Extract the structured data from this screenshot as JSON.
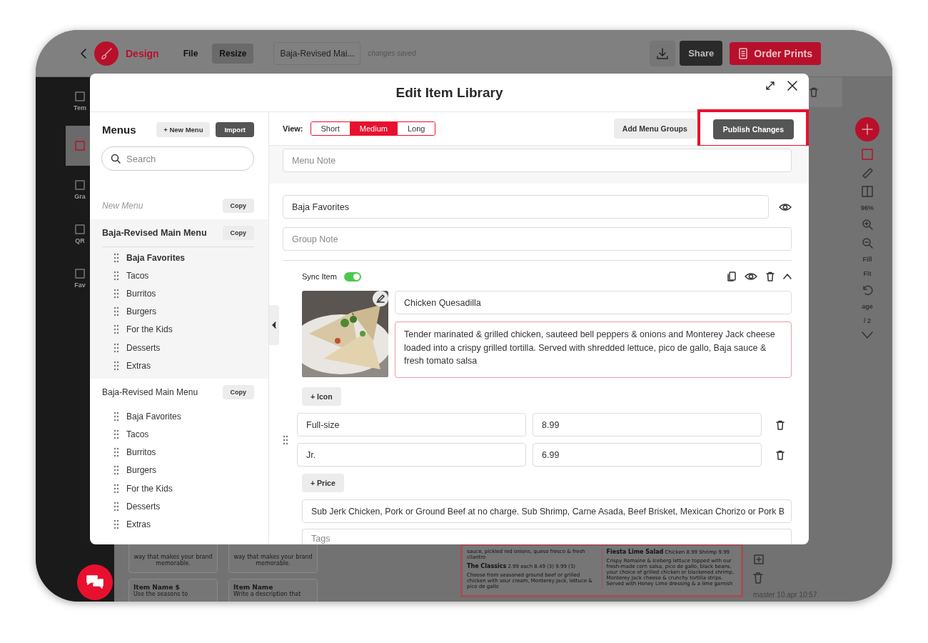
{
  "app_bar": {
    "title": "Design",
    "menu": [
      {
        "label": "File",
        "selected": false
      },
      {
        "label": "Resize",
        "selected": true
      }
    ],
    "document_name": "Baja-Revised Mai...",
    "save_status": "changes saved",
    "share": "Share",
    "order": "Order Prints"
  },
  "left_rail": [
    {
      "label": "Tem",
      "selected": false
    },
    {
      "selected": true
    },
    {
      "label": "Gra",
      "selected": false
    },
    {
      "label": "QR",
      "selected": false
    },
    {
      "label": "Fav",
      "selected": false
    }
  ],
  "right_tools": {
    "zoom": "96%",
    "fill": "Fill",
    "fit": "Fit",
    "page": "age",
    "page_count": "/ 2"
  },
  "canvas": {
    "cards": [
      {
        "lines": [
          "way that makes your brand",
          "memorable."
        ]
      },
      {
        "lines": [
          "way that makes your brand",
          "memorable."
        ]
      },
      {
        "title": "Item Name $",
        "lines": [
          "Use the seasons to"
        ]
      },
      {
        "title": "Item Name",
        "lines": [
          "Write a description that"
        ]
      }
    ],
    "preview_left": [
      {
        "text": "sauce, pickled red onions, queso fresco & fresh cilantro"
      },
      {
        "title": "The Classics",
        "price": "2.99 each  8.49 (3)  9.99 (3)",
        "text": "Choose from seasoned ground beef or grilled chicken with sour cream, Monterey Jack, lettuce & pico de gallo"
      }
    ],
    "preview_right": [
      {
        "title": "Fiesta Lime Salad",
        "price": "Chicken 8.99  Shrimp 9.99",
        "text": "Crispy Romaine & Iceberg lettuce topped with our fresh-made corn salsa, pico de gallo, black beans, your choice of grilled chicken or blackened shrimp, Monterey Jack cheese & crunchy tortilla strips. Served with Honey Lime dressing & a lime garnish"
      }
    ]
  },
  "status": "master 10.apr 10:57",
  "modal": {
    "title": "Edit Item Library",
    "sidebar": {
      "heading": "Menus",
      "new_menu": "+ New Menu",
      "import": "Import",
      "search": {
        "placeholder": "Search"
      },
      "menus": [
        {
          "name": "New Menu",
          "kind": "draft",
          "selected": false,
          "copy": "Copy"
        },
        {
          "name": "Baja-Revised Main Menu",
          "kind": "menu",
          "selected": true,
          "copy": "Copy",
          "groups": [
            {
              "label": "Baja Favorites",
              "selected": true
            },
            {
              "label": "Tacos",
              "selected": false
            },
            {
              "label": "Burritos",
              "selected": false
            },
            {
              "label": "Burgers",
              "selected": false
            },
            {
              "label": "For the Kids",
              "selected": false
            },
            {
              "label": "Desserts",
              "selected": false
            },
            {
              "label": "Extras",
              "selected": false
            }
          ]
        },
        {
          "name": "Baja-Revised Main Menu",
          "kind": "menu",
          "selected": false,
          "copy": "Copy",
          "groups": [
            {
              "label": "Baja Favorites",
              "selected": false
            },
            {
              "label": "Tacos",
              "selected": false
            },
            {
              "label": "Burritos",
              "selected": false
            },
            {
              "label": "Burgers",
              "selected": false
            },
            {
              "label": "For the Kids",
              "selected": false
            },
            {
              "label": "Desserts",
              "selected": false
            },
            {
              "label": "Extras",
              "selected": false
            }
          ]
        }
      ]
    },
    "toolbar": {
      "view_label": "View:",
      "views": [
        {
          "label": "Short",
          "selected": false
        },
        {
          "label": "Medium",
          "selected": true
        },
        {
          "label": "Long",
          "selected": false
        }
      ],
      "add_groups": "Add Menu Groups",
      "publish": {
        "label": "Publish Changes",
        "highlighted": true
      }
    },
    "menu_note": {
      "placeholder": "Menu Note"
    },
    "group": {
      "name": {
        "value": "Baja Favorites"
      },
      "note": {
        "placeholder": "Group Note"
      }
    },
    "item": {
      "sync_label": "Sync Item",
      "sync_on": true,
      "name": {
        "value": "Chicken Quesadilla"
      },
      "description": {
        "value": "Tender marinated & grilled chicken, sauteed bell peppers & onions and Monterey Jack cheese loaded into a crispy grilled tortilla. Served with shredded lettuce, pico de gallo, Baja sauce & fresh tomato salsa"
      },
      "add_icon": "+ Icon",
      "prices": [
        {
          "label": "Full-size",
          "price": "8.99"
        },
        {
          "label": "Jr.",
          "price": "6.99"
        }
      ],
      "add_price": "+ Price",
      "note": {
        "value": "Sub Jerk Chicken, Pork or Ground Beef at no charge. Sub Shrimp, Carne Asada, Beef Brisket, Mexican Chorizo or Pork B"
      },
      "tags": {
        "placeholder": "Tags"
      }
    }
  }
}
